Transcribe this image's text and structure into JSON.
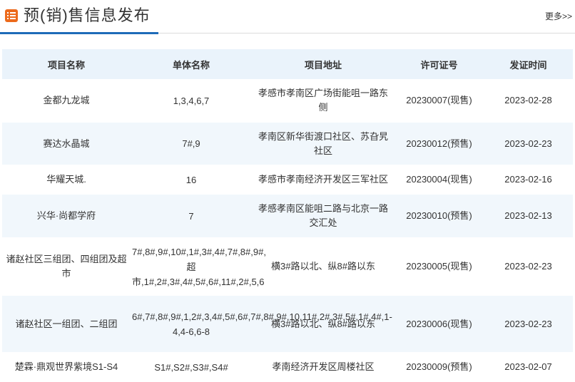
{
  "header": {
    "title": "预(销)售信息发布",
    "more_label": "更多>>",
    "icon": "list-icon",
    "accent_color": "#1e6bb8",
    "icon_color": "#ec6a1c"
  },
  "table": {
    "columns": [
      "项目名称",
      "单体名称",
      "项目地址",
      "许可证号",
      "发证时间"
    ],
    "rows": [
      {
        "project": "金都九龙城",
        "units": "1,3,4,6,7",
        "address": "孝感市孝南区广场街能咀一路东侧",
        "permit": "20230007(现售)",
        "date": "2023-02-28"
      },
      {
        "project": "赛达水晶城",
        "units": "7#,9",
        "address": "孝南区新华街渡口社区、苏旮旯社区",
        "permit": "20230012(预售)",
        "date": "2023-02-23"
      },
      {
        "project": "华耀天城.",
        "units": "16",
        "address": "孝感市孝南经济开发区三军社区",
        "permit": "20230004(现售)",
        "date": "2023-02-16"
      },
      {
        "project": "兴华·尚都学府",
        "units": "7",
        "address": "孝感孝南区能咀二路与北京一路交汇处",
        "permit": "20230010(预售)",
        "date": "2023-02-13"
      },
      {
        "project": "诸赵社区三组团、四组团及超市",
        "units": "7#,8#,9#,10#,1#,3#,4#,7#,8#,9#,超市,1#,2#,3#,4#,5#,6#,11#,2#,5,6",
        "address": "横3#路以北、纵8#路以东",
        "permit": "20230005(现售)",
        "date": "2023-02-23"
      },
      {
        "project": "诸赵社区一组团、二组团",
        "units": "6#,7#,8#,9#,1,2#,3,4#,5#,6#,7#,8#,9#,10,11#,2#,3#,5#,1#,4#,1-4,4-6,6-8",
        "address": "横3#路以北、纵8#路以东",
        "permit": "20230006(现售)",
        "date": "2023-02-23"
      },
      {
        "project": "楚霖·鼎观世界紫境S1-S4",
        "units": "S1#,S2#,S3#,S4#",
        "address": "孝南经济开发区周楼社区",
        "permit": "20230009(预售)",
        "date": "2023-02-07"
      }
    ]
  }
}
